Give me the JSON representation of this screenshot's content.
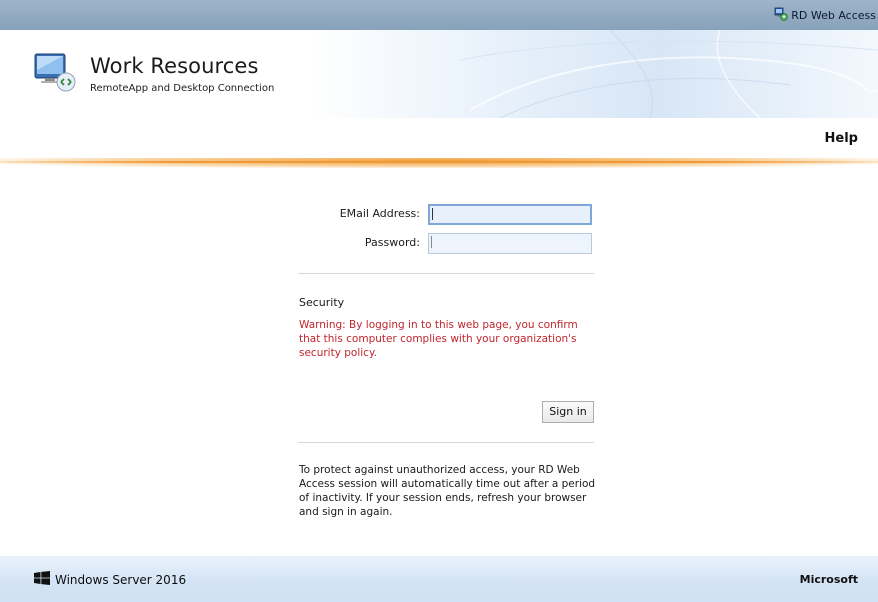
{
  "topbar": {
    "link_label": "RD Web Access",
    "icon": "rd-web-access-icon"
  },
  "header": {
    "title": "Work Resources",
    "subtitle": "RemoteApp and Desktop Connection",
    "logo_icon": "remote-desktop-monitor-icon"
  },
  "nav": {
    "help_label": "Help"
  },
  "accent_colors": {
    "orange_rule": "#ef9a3a",
    "warning": "#c0262d",
    "topbar": "#90aac2"
  },
  "login": {
    "email_label": "EMail Address:",
    "email_value": "",
    "password_label": "Password:",
    "password_value": "",
    "security_title": "Security",
    "warning_text": "Warning: By logging in to this web page, you confirm that this computer complies with your organization's security policy.",
    "signin_label": "Sign in",
    "info_text": "To protect against unauthorized access, your RD Web Access session will automatically time out after a period of inactivity. If your session ends, refresh your browser and sign in again."
  },
  "footer": {
    "product": "Windows Server 2016",
    "product_icon": "windows-logo-icon",
    "vendor": "Microsoft"
  }
}
